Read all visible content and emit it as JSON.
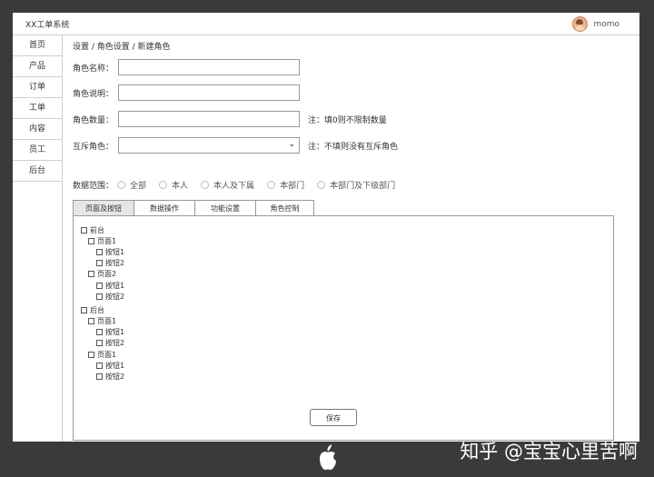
{
  "header": {
    "app_title": "XX工单系统",
    "username": "momo"
  },
  "sidebar": {
    "items": [
      {
        "label": "首页"
      },
      {
        "label": "产品"
      },
      {
        "label": "订单"
      },
      {
        "label": "工单"
      },
      {
        "label": "内容"
      },
      {
        "label": "员工"
      },
      {
        "label": "后台"
      }
    ]
  },
  "breadcrumb": "设置 / 角色设置 / 新建角色",
  "form": {
    "role_name_label": "角色名称：",
    "role_name_value": "",
    "role_desc_label": "角色说明：",
    "role_desc_value": "",
    "role_count_label": "角色数量：",
    "role_count_value": "",
    "role_count_note": "注：填0则不限制数量",
    "mutex_label": "互斥角色：",
    "mutex_value": "",
    "mutex_note": "注：不填则没有互斥角色"
  },
  "data_scope": {
    "label": "数据范围：",
    "options": [
      "全部",
      "本人",
      "本人及下属",
      "本部门",
      "本部门及下级部门"
    ]
  },
  "tabs": [
    {
      "label": "页面及按钮",
      "active": true
    },
    {
      "label": "数据操作",
      "active": false
    },
    {
      "label": "功能设置",
      "active": false
    },
    {
      "label": "角色控制",
      "active": false
    }
  ],
  "tree": [
    {
      "level": 1,
      "label": "前台"
    },
    {
      "level": 2,
      "label": "页面1"
    },
    {
      "level": 3,
      "label": "按钮1"
    },
    {
      "level": 3,
      "label": "按钮2"
    },
    {
      "level": 2,
      "label": "页面2"
    },
    {
      "level": 3,
      "label": "按钮1"
    },
    {
      "level": 3,
      "label": "按钮2"
    },
    {
      "level": 1,
      "label": "后台"
    },
    {
      "level": 2,
      "label": "页面1"
    },
    {
      "level": 3,
      "label": "按钮1"
    },
    {
      "level": 3,
      "label": "按钮2"
    },
    {
      "level": 2,
      "label": "页面1"
    },
    {
      "level": 3,
      "label": "按钮1"
    },
    {
      "level": 3,
      "label": "按钮2"
    }
  ],
  "save_label": "保存",
  "watermark": "知乎 @宝宝心里苦啊"
}
